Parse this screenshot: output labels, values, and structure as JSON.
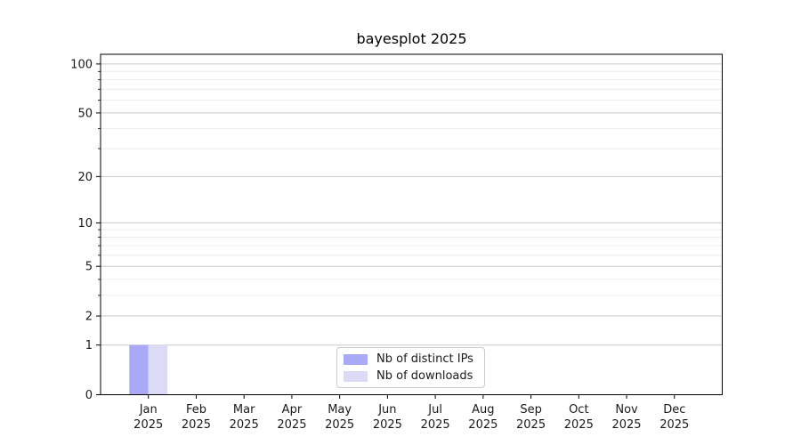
{
  "chart_data": {
    "type": "bar",
    "title": "bayesplot 2025",
    "yscale": "log1p",
    "ylim": [
      0,
      100
    ],
    "grid": "horizontal",
    "legend_position": "lower center",
    "categories": [
      "Jan",
      "Feb",
      "Mar",
      "Apr",
      "May",
      "Jun",
      "Jul",
      "Aug",
      "Sep",
      "Oct",
      "Nov",
      "Dec"
    ],
    "x_tick_year": "2025",
    "y_major_ticks": [
      0,
      1,
      2,
      5,
      10,
      20,
      50,
      100
    ],
    "y_minor_gridlines": [
      3,
      4,
      6,
      7,
      8,
      9,
      30,
      40,
      60,
      70,
      80,
      90
    ],
    "series": [
      {
        "name": "Nb of distinct IPs",
        "color": "#a9a9f8",
        "values": [
          1,
          0,
          0,
          0,
          0,
          0,
          0,
          0,
          0,
          0,
          0,
          0
        ]
      },
      {
        "name": "Nb of downloads",
        "color": "#dbdbf8",
        "values": [
          1,
          0,
          0,
          0,
          0,
          0,
          0,
          0,
          0,
          0,
          0,
          0
        ]
      }
    ],
    "colors": {
      "major_grid": "#c9c9c9",
      "minor_grid": "#ececec",
      "spine": "#000000",
      "text": "#1a1a1a"
    }
  }
}
